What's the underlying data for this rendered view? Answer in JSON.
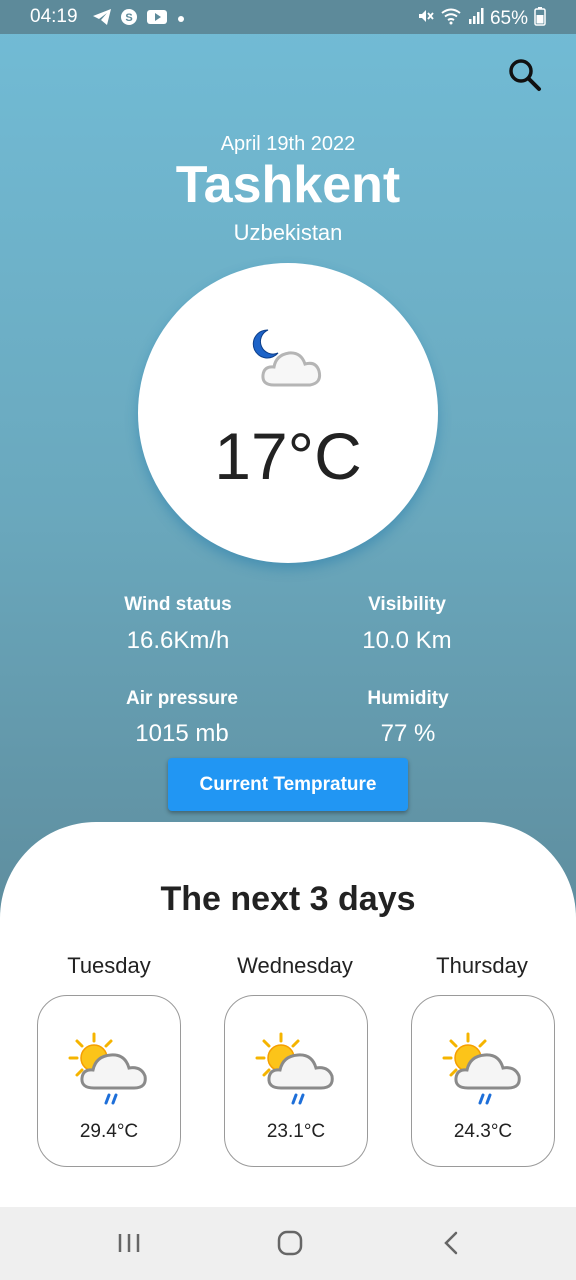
{
  "status_bar": {
    "time": "04:19",
    "battery": "65%",
    "left_icons": [
      "telegram-icon",
      "skype-icon",
      "youtube-icon",
      "dot-icon"
    ],
    "right_icons": [
      "mute-icon",
      "wifi-icon",
      "signal-icon",
      "battery-icon"
    ]
  },
  "header": {
    "date": "April 19th 2022",
    "city": "Tashkent",
    "country": "Uzbekistan"
  },
  "current": {
    "icon": "night-partly-cloudy-icon",
    "temperature": "17°C"
  },
  "stats": {
    "wind_label": "Wind status",
    "wind_value": "16.6Km/h",
    "visibility_label": "Visibility",
    "visibility_value": "10.0 Km",
    "pressure_label": "Air pressure",
    "pressure_value": "1015 mb",
    "humidity_label": "Humidity",
    "humidity_value": "77 %"
  },
  "button_label": "Current Temprature",
  "forecast": {
    "title": "The next 3 days",
    "days": [
      {
        "name": "Tuesday",
        "temp": "29.4°C",
        "icon": "sun-cloud-rain-icon"
      },
      {
        "name": "Wednesday",
        "temp": "23.1°C",
        "icon": "sun-cloud-rain-icon"
      },
      {
        "name": "Thursday",
        "temp": "24.3°C",
        "icon": "sun-cloud-rain-icon"
      }
    ]
  },
  "colors": {
    "accent": "#2196f3",
    "background_top": "#72bcd6",
    "background_bottom": "#58818f"
  }
}
